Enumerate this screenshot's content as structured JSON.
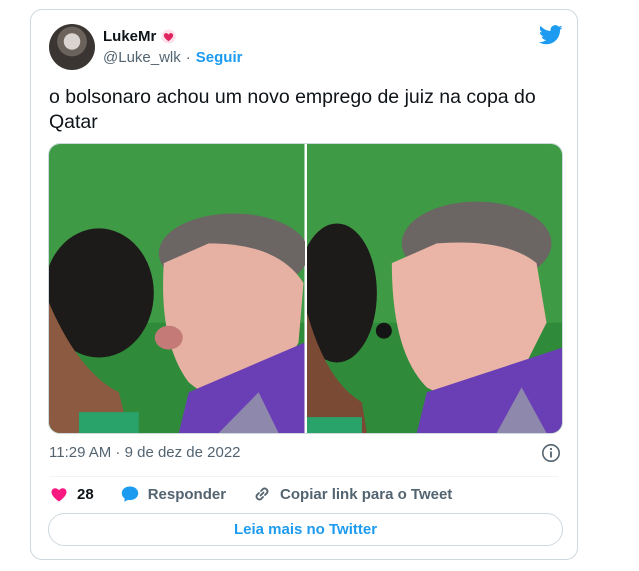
{
  "tweet": {
    "author_name": "LukeMr",
    "author_handle": "@Luke_wlk",
    "separator": "·",
    "follow_label": "Seguir",
    "text": "o bolsonaro achou um novo emprego de juiz na copa do Qatar",
    "timestamp": "11:29 AM · 9 de dez de 2022",
    "likes": "28",
    "reply_label": "Responder",
    "copy_label": "Copiar link para o Tweet",
    "read_more_label": "Leia mais no Twitter"
  },
  "icons": {
    "badge": "heart-badge-icon",
    "brand": "twitter-bird-icon",
    "info": "info-icon",
    "like": "heart-icon",
    "reply": "reply-bubble-icon",
    "copy": "link-icon"
  },
  "colors": {
    "accent": "#1d9bf0",
    "like": "#f91880",
    "secondary_text": "#536471",
    "border": "#cfd9de"
  }
}
